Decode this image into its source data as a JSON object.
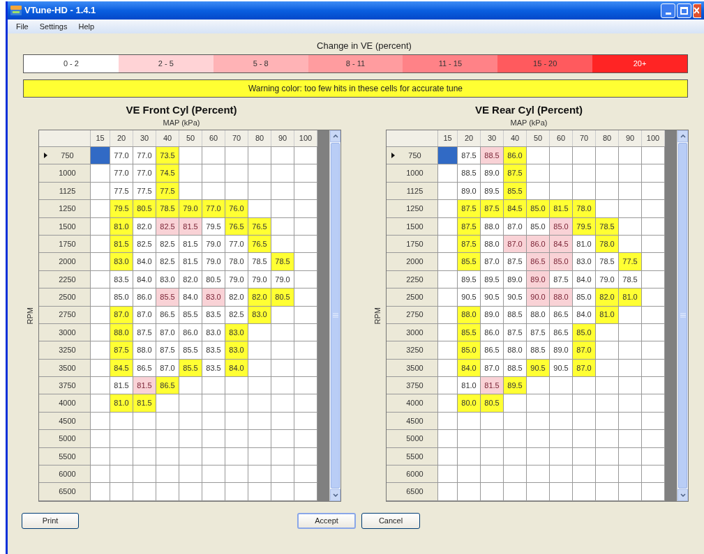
{
  "window": {
    "title": "VTune-HD - 1.4.1"
  },
  "menu": [
    "File",
    "Settings",
    "Help"
  ],
  "legend": {
    "title": "Change in VE (percent)",
    "bands": [
      {
        "label": "0 - 2",
        "color": "#ffffff"
      },
      {
        "label": "2 - 5",
        "color": "#ffd3d6"
      },
      {
        "label": "5 - 8",
        "color": "#ffb3b6"
      },
      {
        "label": "8 - 11",
        "color": "#ff9c9f"
      },
      {
        "label": "11 - 15",
        "color": "#ff8287"
      },
      {
        "label": "15 - 20",
        "color": "#ff5a5e"
      },
      {
        "label": "20+",
        "color": "#ff2424"
      }
    ]
  },
  "warning": "Warning color: too few hits in these cells for accurate tune",
  "tables": [
    {
      "title": "VE Front Cyl (Percent)",
      "x_axis": "MAP (kPa)",
      "y_axis": "RPM",
      "columns": [
        "15",
        "20",
        "30",
        "40",
        "50",
        "60",
        "70",
        "80",
        "90",
        "100"
      ],
      "rows": [
        {
          "rpm": "750",
          "selected": true,
          "cells": [
            "",
            {
              "value": "77.0",
              "warning": false,
              "changed": false
            },
            {
              "value": "77.0",
              "warning": false,
              "changed": false
            },
            {
              "value": "73.5",
              "warning": true,
              "changed": false
            }
          ]
        },
        {
          "rpm": "1000",
          "selected": false,
          "cells": [
            "",
            {
              "value": "77.0",
              "warning": false,
              "changed": false
            },
            {
              "value": "77.0",
              "warning": false,
              "changed": false
            },
            {
              "value": "74.5",
              "warning": true,
              "changed": false
            }
          ]
        },
        {
          "rpm": "1125",
          "selected": false,
          "cells": [
            "",
            {
              "value": "77.5",
              "warning": false,
              "changed": false
            },
            {
              "value": "77.5",
              "warning": false,
              "changed": false
            },
            {
              "value": "77.5",
              "warning": true,
              "changed": false
            }
          ]
        },
        {
          "rpm": "1250",
          "selected": false,
          "cells": [
            "",
            {
              "value": "79.5",
              "warning": true,
              "changed": false
            },
            {
              "value": "80.5",
              "warning": true,
              "changed": false
            },
            {
              "value": "78.5",
              "warning": true,
              "changed": false
            },
            {
              "value": "79.0",
              "warning": true,
              "changed": false
            },
            {
              "value": "77.0",
              "warning": true,
              "changed": false
            },
            {
              "value": "76.0",
              "warning": true,
              "changed": false
            }
          ]
        },
        {
          "rpm": "1500",
          "selected": false,
          "cells": [
            "",
            {
              "value": "81.0",
              "warning": true,
              "changed": false
            },
            {
              "value": "82.0",
              "warning": false,
              "changed": false
            },
            {
              "value": "82.5",
              "warning": false,
              "changed": true
            },
            {
              "value": "81.5",
              "warning": false,
              "changed": true
            },
            {
              "value": "79.5",
              "warning": false,
              "changed": false
            },
            {
              "value": "76.5",
              "warning": true,
              "changed": false
            },
            {
              "value": "76.5",
              "warning": true,
              "changed": false
            }
          ]
        },
        {
          "rpm": "1750",
          "selected": false,
          "cells": [
            "",
            {
              "value": "81.5",
              "warning": true,
              "changed": false
            },
            {
              "value": "82.5",
              "warning": false,
              "changed": false
            },
            {
              "value": "82.5",
              "warning": false,
              "changed": false
            },
            {
              "value": "81.5",
              "warning": false,
              "changed": false
            },
            {
              "value": "79.0",
              "warning": false,
              "changed": false
            },
            {
              "value": "77.0",
              "warning": false,
              "changed": false
            },
            {
              "value": "76.5",
              "warning": true,
              "changed": false
            }
          ]
        },
        {
          "rpm": "2000",
          "selected": false,
          "cells": [
            "",
            {
              "value": "83.0",
              "warning": true,
              "changed": false
            },
            {
              "value": "84.0",
              "warning": false,
              "changed": false
            },
            {
              "value": "82.5",
              "warning": false,
              "changed": false
            },
            {
              "value": "81.5",
              "warning": false,
              "changed": false
            },
            {
              "value": "79.0",
              "warning": false,
              "changed": false
            },
            {
              "value": "78.0",
              "warning": false,
              "changed": false
            },
            {
              "value": "78.5",
              "warning": false,
              "changed": false
            },
            {
              "value": "78.5",
              "warning": true,
              "changed": false
            }
          ]
        },
        {
          "rpm": "2250",
          "selected": false,
          "cells": [
            "",
            {
              "value": "83.5",
              "warning": false,
              "changed": false
            },
            {
              "value": "84.0",
              "warning": false,
              "changed": false
            },
            {
              "value": "83.0",
              "warning": false,
              "changed": false
            },
            {
              "value": "82.0",
              "warning": false,
              "changed": false
            },
            {
              "value": "80.5",
              "warning": false,
              "changed": false
            },
            {
              "value": "79.0",
              "warning": false,
              "changed": false
            },
            {
              "value": "79.0",
              "warning": false,
              "changed": false
            },
            {
              "value": "79.0",
              "warning": false,
              "changed": false
            }
          ]
        },
        {
          "rpm": "2500",
          "selected": false,
          "cells": [
            "",
            {
              "value": "85.0",
              "warning": false,
              "changed": false
            },
            {
              "value": "86.0",
              "warning": false,
              "changed": false
            },
            {
              "value": "85.5",
              "warning": false,
              "changed": true
            },
            {
              "value": "84.0",
              "warning": false,
              "changed": false
            },
            {
              "value": "83.0",
              "warning": false,
              "changed": true
            },
            {
              "value": "82.0",
              "warning": false,
              "changed": false
            },
            {
              "value": "82.0",
              "warning": true,
              "changed": false
            },
            {
              "value": "80.5",
              "warning": true,
              "changed": false
            }
          ]
        },
        {
          "rpm": "2750",
          "selected": false,
          "cells": [
            "",
            {
              "value": "87.0",
              "warning": true,
              "changed": false
            },
            {
              "value": "87.0",
              "warning": false,
              "changed": false
            },
            {
              "value": "86.5",
              "warning": false,
              "changed": false
            },
            {
              "value": "85.5",
              "warning": false,
              "changed": false
            },
            {
              "value": "83.5",
              "warning": false,
              "changed": false
            },
            {
              "value": "82.5",
              "warning": false,
              "changed": false
            },
            {
              "value": "83.0",
              "warning": true,
              "changed": false
            }
          ]
        },
        {
          "rpm": "3000",
          "selected": false,
          "cells": [
            "",
            {
              "value": "88.0",
              "warning": true,
              "changed": false
            },
            {
              "value": "87.5",
              "warning": false,
              "changed": false
            },
            {
              "value": "87.0",
              "warning": false,
              "changed": false
            },
            {
              "value": "86.0",
              "warning": false,
              "changed": false
            },
            {
              "value": "83.0",
              "warning": false,
              "changed": false
            },
            {
              "value": "83.0",
              "warning": true,
              "changed": false
            }
          ]
        },
        {
          "rpm": "3250",
          "selected": false,
          "cells": [
            "",
            {
              "value": "87.5",
              "warning": true,
              "changed": false
            },
            {
              "value": "88.0",
              "warning": false,
              "changed": false
            },
            {
              "value": "87.5",
              "warning": false,
              "changed": false
            },
            {
              "value": "85.5",
              "warning": false,
              "changed": false
            },
            {
              "value": "83.5",
              "warning": false,
              "changed": false
            },
            {
              "value": "83.0",
              "warning": true,
              "changed": false
            }
          ]
        },
        {
          "rpm": "3500",
          "selected": false,
          "cells": [
            "",
            {
              "value": "84.5",
              "warning": true,
              "changed": false
            },
            {
              "value": "86.5",
              "warning": false,
              "changed": false
            },
            {
              "value": "87.0",
              "warning": false,
              "changed": false
            },
            {
              "value": "85.5",
              "warning": true,
              "changed": false
            },
            {
              "value": "83.5",
              "warning": false,
              "changed": false
            },
            {
              "value": "84.0",
              "warning": true,
              "changed": false
            }
          ]
        },
        {
          "rpm": "3750",
          "selected": false,
          "cells": [
            "",
            {
              "value": "81.5",
              "warning": false,
              "changed": false
            },
            {
              "value": "81.5",
              "warning": false,
              "changed": true
            },
            {
              "value": "86.5",
              "warning": true,
              "changed": false
            }
          ]
        },
        {
          "rpm": "4000",
          "selected": false,
          "cells": [
            "",
            {
              "value": "81.0",
              "warning": true,
              "changed": false
            },
            {
              "value": "81.5",
              "warning": true,
              "changed": false
            }
          ]
        },
        {
          "rpm": "4500",
          "selected": false
        },
        {
          "rpm": "5000",
          "selected": false
        },
        {
          "rpm": "5500",
          "selected": false
        },
        {
          "rpm": "6000",
          "selected": false
        },
        {
          "rpm": "6500",
          "selected": false
        }
      ]
    },
    {
      "title": "VE Rear Cyl (Percent)",
      "x_axis": "MAP (kPa)",
      "y_axis": "RPM",
      "columns": [
        "15",
        "20",
        "30",
        "40",
        "50",
        "60",
        "70",
        "80",
        "90",
        "100"
      ],
      "rows": [
        {
          "rpm": "750",
          "selected": true,
          "cells": [
            "",
            {
              "value": "87.5",
              "warning": false,
              "changed": false
            },
            {
              "value": "88.5",
              "warning": false,
              "changed": true
            },
            {
              "value": "86.0",
              "warning": true,
              "changed": false
            }
          ]
        },
        {
          "rpm": "1000",
          "selected": false,
          "cells": [
            "",
            {
              "value": "88.5",
              "warning": false,
              "changed": false
            },
            {
              "value": "89.0",
              "warning": false,
              "changed": false
            },
            {
              "value": "87.5",
              "warning": true,
              "changed": false
            }
          ]
        },
        {
          "rpm": "1125",
          "selected": false,
          "cells": [
            "",
            {
              "value": "89.0",
              "warning": false,
              "changed": false
            },
            {
              "value": "89.5",
              "warning": false,
              "changed": false
            },
            {
              "value": "85.5",
              "warning": true,
              "changed": false
            }
          ]
        },
        {
          "rpm": "1250",
          "selected": false,
          "cells": [
            "",
            {
              "value": "87.5",
              "warning": true,
              "changed": false
            },
            {
              "value": "87.5",
              "warning": true,
              "changed": false
            },
            {
              "value": "84.5",
              "warning": true,
              "changed": false
            },
            {
              "value": "85.0",
              "warning": true,
              "changed": false
            },
            {
              "value": "81.5",
              "warning": true,
              "changed": false
            },
            {
              "value": "78.0",
              "warning": true,
              "changed": false
            }
          ]
        },
        {
          "rpm": "1500",
          "selected": false,
          "cells": [
            "",
            {
              "value": "87.5",
              "warning": true,
              "changed": false
            },
            {
              "value": "88.0",
              "warning": false,
              "changed": false
            },
            {
              "value": "87.0",
              "warning": false,
              "changed": false
            },
            {
              "value": "85.0",
              "warning": false,
              "changed": false
            },
            {
              "value": "85.0",
              "warning": false,
              "changed": true
            },
            {
              "value": "79.5",
              "warning": true,
              "changed": false
            },
            {
              "value": "78.5",
              "warning": true,
              "changed": false
            }
          ]
        },
        {
          "rpm": "1750",
          "selected": false,
          "cells": [
            "",
            {
              "value": "87.5",
              "warning": true,
              "changed": false
            },
            {
              "value": "88.0",
              "warning": false,
              "changed": false
            },
            {
              "value": "87.0",
              "warning": false,
              "changed": true
            },
            {
              "value": "86.0",
              "warning": false,
              "changed": true
            },
            {
              "value": "84.5",
              "warning": false,
              "changed": true
            },
            {
              "value": "81.0",
              "warning": false,
              "changed": false
            },
            {
              "value": "78.0",
              "warning": true,
              "changed": false
            }
          ]
        },
        {
          "rpm": "2000",
          "selected": false,
          "cells": [
            "",
            {
              "value": "85.5",
              "warning": true,
              "changed": false
            },
            {
              "value": "87.0",
              "warning": false,
              "changed": false
            },
            {
              "value": "87.5",
              "warning": false,
              "changed": false
            },
            {
              "value": "86.5",
              "warning": false,
              "changed": true
            },
            {
              "value": "85.0",
              "warning": false,
              "changed": true
            },
            {
              "value": "83.0",
              "warning": false,
              "changed": false
            },
            {
              "value": "78.5",
              "warning": false,
              "changed": false
            },
            {
              "value": "77.5",
              "warning": true,
              "changed": false
            }
          ]
        },
        {
          "rpm": "2250",
          "selected": false,
          "cells": [
            "",
            {
              "value": "89.5",
              "warning": false,
              "changed": false
            },
            {
              "value": "89.5",
              "warning": false,
              "changed": false
            },
            {
              "value": "89.0",
              "warning": false,
              "changed": false
            },
            {
              "value": "89.0",
              "warning": false,
              "changed": true
            },
            {
              "value": "87.5",
              "warning": false,
              "changed": false
            },
            {
              "value": "84.0",
              "warning": false,
              "changed": false
            },
            {
              "value": "79.0",
              "warning": false,
              "changed": false
            },
            {
              "value": "78.5",
              "warning": false,
              "changed": false
            }
          ]
        },
        {
          "rpm": "2500",
          "selected": false,
          "cells": [
            "",
            {
              "value": "90.5",
              "warning": false,
              "changed": false
            },
            {
              "value": "90.5",
              "warning": false,
              "changed": false
            },
            {
              "value": "90.5",
              "warning": false,
              "changed": false
            },
            {
              "value": "90.0",
              "warning": false,
              "changed": true
            },
            {
              "value": "88.0",
              "warning": false,
              "changed": true
            },
            {
              "value": "85.0",
              "warning": false,
              "changed": false
            },
            {
              "value": "82.0",
              "warning": true,
              "changed": false
            },
            {
              "value": "81.0",
              "warning": true,
              "changed": false
            }
          ]
        },
        {
          "rpm": "2750",
          "selected": false,
          "cells": [
            "",
            {
              "value": "88.0",
              "warning": true,
              "changed": false
            },
            {
              "value": "89.0",
              "warning": false,
              "changed": false
            },
            {
              "value": "88.5",
              "warning": false,
              "changed": false
            },
            {
              "value": "88.0",
              "warning": false,
              "changed": false
            },
            {
              "value": "86.5",
              "warning": false,
              "changed": false
            },
            {
              "value": "84.0",
              "warning": false,
              "changed": false
            },
            {
              "value": "81.0",
              "warning": true,
              "changed": false
            }
          ]
        },
        {
          "rpm": "3000",
          "selected": false,
          "cells": [
            "",
            {
              "value": "85.5",
              "warning": true,
              "changed": false
            },
            {
              "value": "86.0",
              "warning": false,
              "changed": false
            },
            {
              "value": "87.5",
              "warning": false,
              "changed": false
            },
            {
              "value": "87.5",
              "warning": false,
              "changed": false
            },
            {
              "value": "86.5",
              "warning": false,
              "changed": false
            },
            {
              "value": "85.0",
              "warning": true,
              "changed": false
            }
          ]
        },
        {
          "rpm": "3250",
          "selected": false,
          "cells": [
            "",
            {
              "value": "85.0",
              "warning": true,
              "changed": false
            },
            {
              "value": "86.5",
              "warning": false,
              "changed": false
            },
            {
              "value": "88.0",
              "warning": false,
              "changed": false
            },
            {
              "value": "88.5",
              "warning": false,
              "changed": false
            },
            {
              "value": "89.0",
              "warning": false,
              "changed": false
            },
            {
              "value": "87.0",
              "warning": true,
              "changed": false
            }
          ]
        },
        {
          "rpm": "3500",
          "selected": false,
          "cells": [
            "",
            {
              "value": "84.0",
              "warning": true,
              "changed": false
            },
            {
              "value": "87.0",
              "warning": false,
              "changed": false
            },
            {
              "value": "88.5",
              "warning": false,
              "changed": false
            },
            {
              "value": "90.5",
              "warning": true,
              "changed": false
            },
            {
              "value": "90.5",
              "warning": false,
              "changed": false
            },
            {
              "value": "87.0",
              "warning": true,
              "changed": false
            }
          ]
        },
        {
          "rpm": "3750",
          "selected": false,
          "cells": [
            "",
            {
              "value": "81.0",
              "warning": false,
              "changed": false
            },
            {
              "value": "81.5",
              "warning": false,
              "changed": true
            },
            {
              "value": "89.5",
              "warning": true,
              "changed": false
            }
          ]
        },
        {
          "rpm": "4000",
          "selected": false,
          "cells": [
            "",
            {
              "value": "80.0",
              "warning": true,
              "changed": false
            },
            {
              "value": "80.5",
              "warning": true,
              "changed": false
            }
          ]
        },
        {
          "rpm": "4500",
          "selected": false
        },
        {
          "rpm": "5000",
          "selected": false
        },
        {
          "rpm": "5500",
          "selected": false
        },
        {
          "rpm": "6000",
          "selected": false
        },
        {
          "rpm": "6500",
          "selected": false
        }
      ]
    }
  ],
  "buttons": [
    {
      "label": "Print",
      "default": false
    },
    {
      "label": "Accept",
      "default": true
    },
    {
      "label": "Cancel",
      "default": false
    }
  ]
}
